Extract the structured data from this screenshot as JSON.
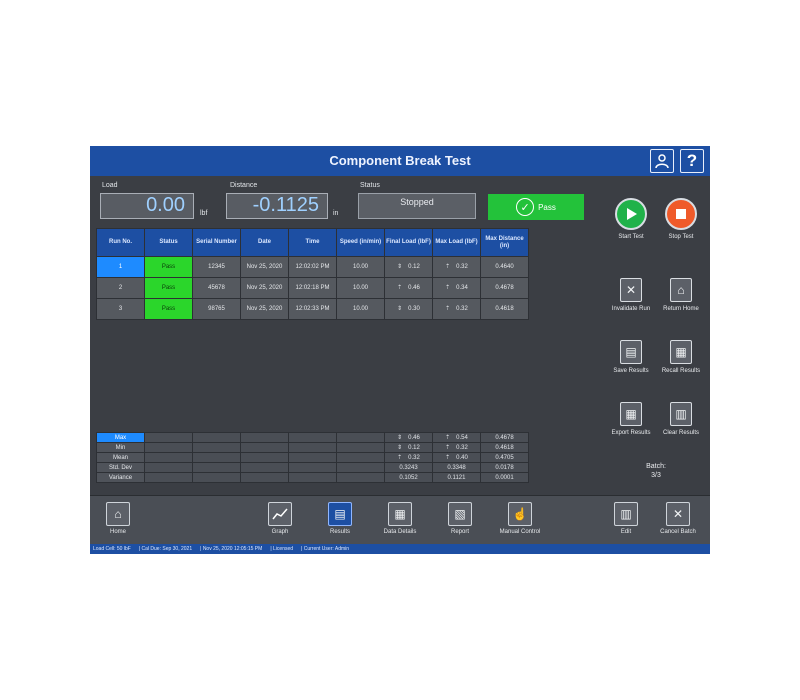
{
  "window": {
    "title": "Component Break Test",
    "user_icon": "user-icon",
    "help_label": "?"
  },
  "readouts": {
    "load_label": "Load",
    "load_value": "0.00",
    "load_unit": "lbf",
    "distance_label": "Distance",
    "distance_value": "-0.1125",
    "distance_unit": "in",
    "status_label": "Status",
    "status_value": "Stopped",
    "result_label": "Pass",
    "result_color": "#23c23a"
  },
  "table": {
    "headers": [
      "Run No.",
      "Status",
      "Serial Number",
      "Date",
      "Time",
      "Speed (in/min)",
      "Final Load (lbF)",
      "Max Load (lbF)",
      "Max Distance (in)"
    ],
    "rows": [
      [
        "1",
        "Pass",
        "12345",
        "Nov 25, 2020",
        "12:02:02 PM",
        "10.00",
        "0.12",
        "0.32",
        "0.4640"
      ],
      [
        "2",
        "Pass",
        "45678",
        "Nov 25, 2020",
        "12:02:18 PM",
        "10.00",
        "0.46",
        "0.34",
        "0.4678"
      ],
      [
        "3",
        "Pass",
        "98765",
        "Nov 25, 2020",
        "12:02:33 PM",
        "10.00",
        "0.30",
        "0.32",
        "0.4618"
      ]
    ]
  },
  "stats": {
    "labels": [
      "Max",
      "Min",
      "Mean",
      "Std. Dev",
      "Variance"
    ],
    "final_load": [
      "0.46",
      "0.12",
      "0.32",
      "0.3243",
      "0.1052"
    ],
    "max_load": [
      "0.54",
      "0.32",
      "0.40",
      "0.3348",
      "0.1121"
    ],
    "max_distance": [
      "0.4678",
      "0.4618",
      "0.4705",
      "0.0178",
      "0.0001"
    ]
  },
  "side": {
    "start": "Start Test",
    "stop": "Stop Test",
    "invalidate": "Invalidate Run",
    "return_home": "Return Home",
    "save": "Save Results",
    "recall": "Recall Results",
    "export": "Export Results",
    "clear": "Clear Results",
    "batch_label": "Batch:",
    "batch_value": "3/3"
  },
  "bottom": {
    "home": "Home",
    "graph": "Graph",
    "results": "Results",
    "data_details": "Data Details",
    "report": "Report",
    "manual_control": "Manual Control",
    "edit": "Edit",
    "cancel_batch": "Cancel Batch"
  },
  "statusbar": {
    "load_cell": "Load Cell: 50 lbF",
    "cal_due": "Cal Due: Sep 30, 2021",
    "datetime": "Nov 25, 2020 12:05:15 PM",
    "license": "Licensed",
    "user": "Current User: Admin"
  }
}
